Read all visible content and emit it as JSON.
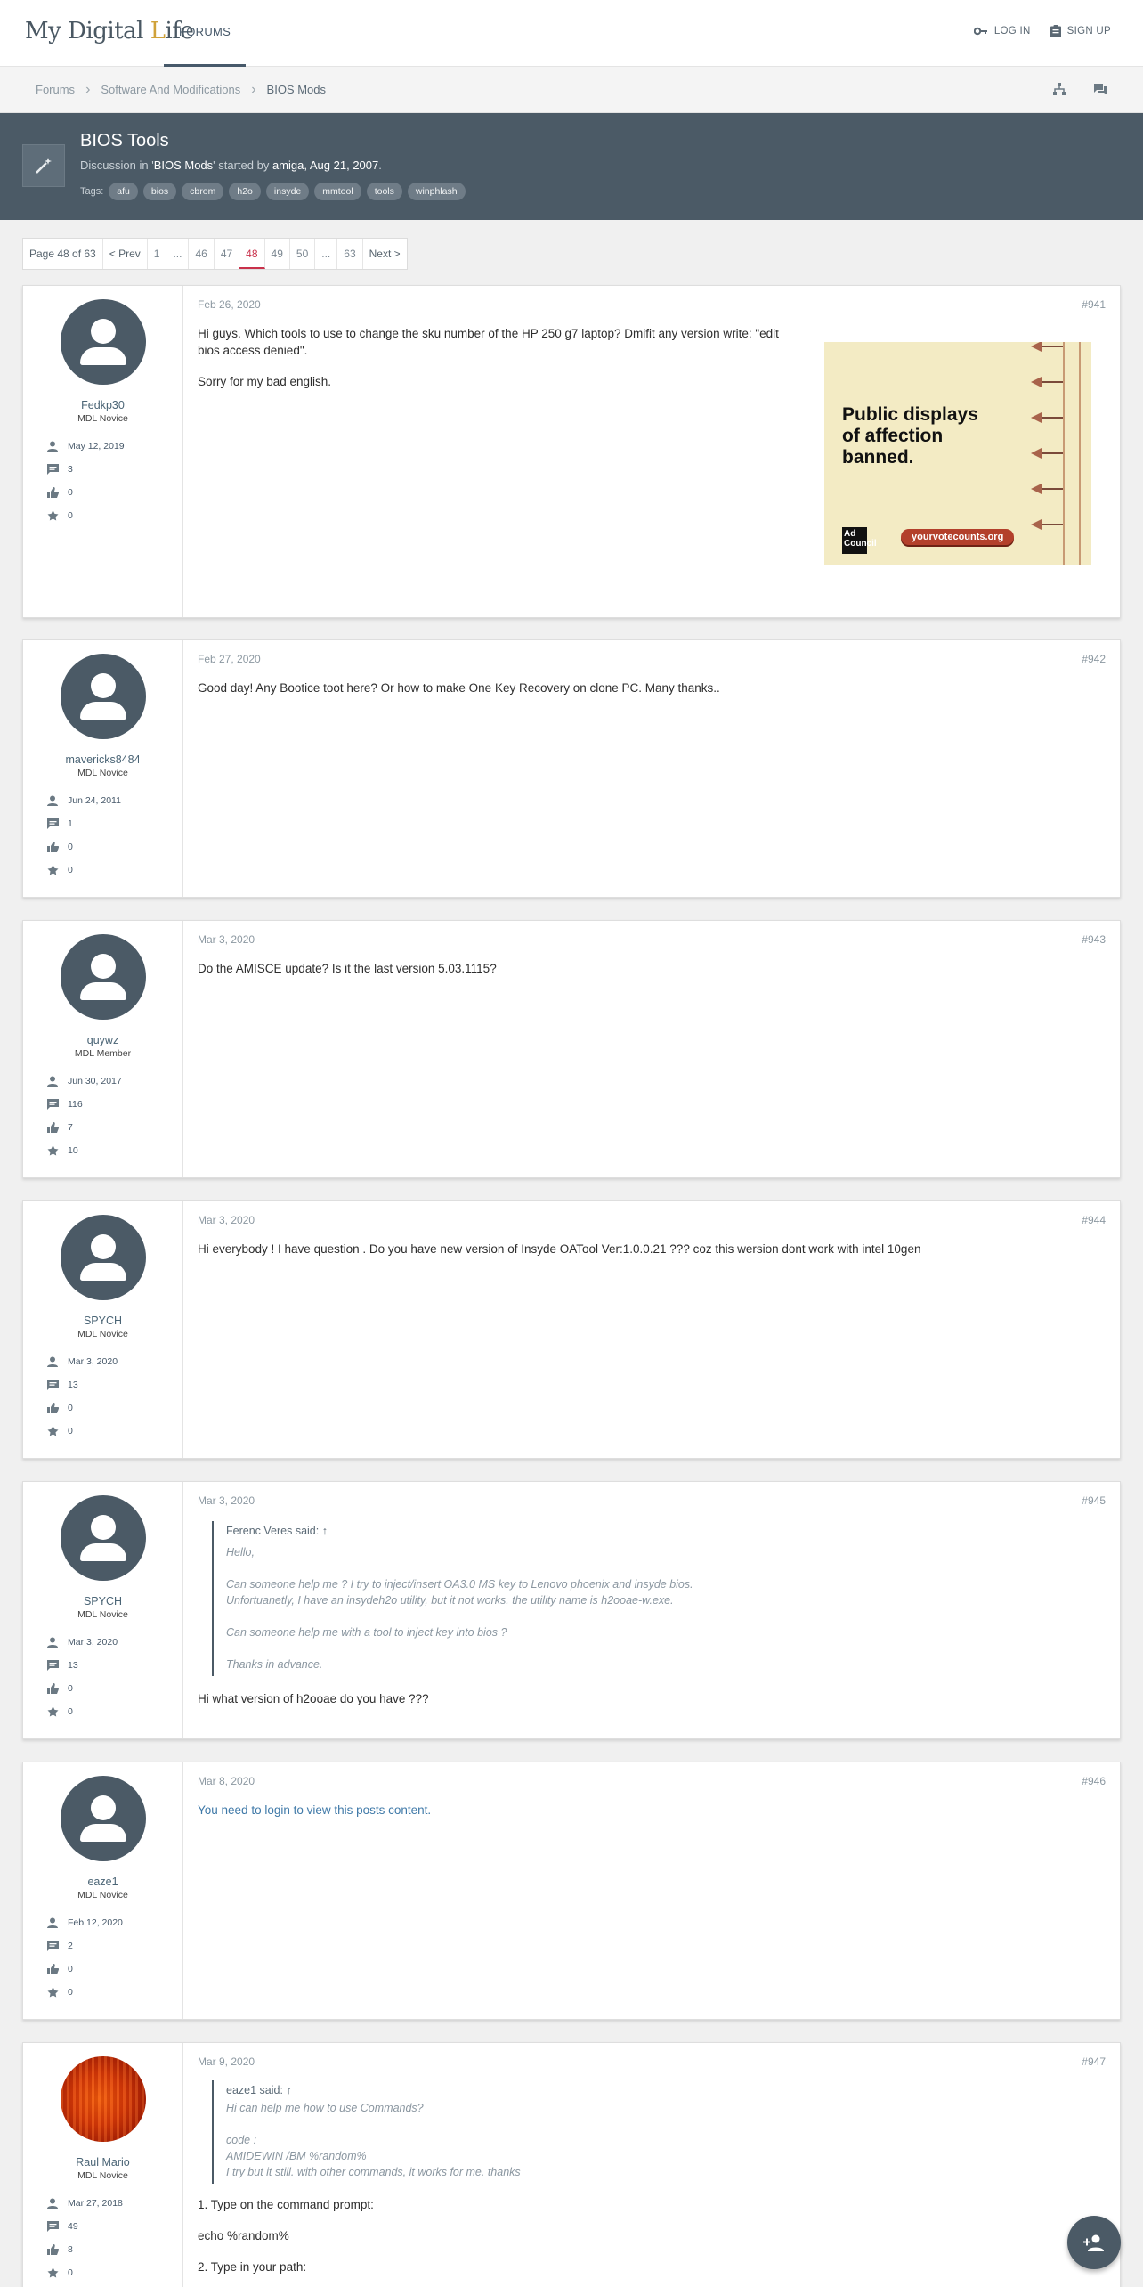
{
  "site": {
    "logo_main": "My Digital ",
    "logo_accent": "L",
    "logo_end": "ife"
  },
  "nav": {
    "forums": "FORUMS",
    "login": "LOG IN",
    "signup": "SIGN UP"
  },
  "breadcrumb": [
    "Forums",
    "Software And Modifications",
    "BIOS Mods"
  ],
  "thread": {
    "title": "BIOS Tools",
    "meta_prefix": "Discussion in '",
    "meta_forum": "BIOS Mods",
    "meta_mid": "' started by ",
    "meta_author": "amiga",
    "meta_sep": ", ",
    "meta_date": "Aug 21, 2007",
    "meta_end": ".",
    "tags_label": "Tags:",
    "tags": [
      "afu",
      "bios",
      "cbrom",
      "h2o",
      "insyde",
      "mmtool",
      "tools",
      "winphlash"
    ]
  },
  "pagination": {
    "label": "Page 48 of 63",
    "prev": "< Prev",
    "pages": [
      "1",
      "...",
      "46",
      "47",
      "48",
      "49",
      "50",
      "...",
      "63"
    ],
    "current": "48",
    "next": "Next >"
  },
  "posts": [
    {
      "user": "Fedkp30",
      "rank": "MDL Novice",
      "joined": "May 12, 2019",
      "messages": "3",
      "likes": "0",
      "points": "0",
      "date": "Feb 26, 2020",
      "num": "#941",
      "lines": [
        "Hi guys. Which tools to use to change the sku number of the HP 250 g7 laptop? Dmifit any version write: \"edit",
        "bios access denied\".",
        "Sorry for my bad english."
      ]
    },
    {
      "user": "mavericks8484",
      "rank": "MDL Novice",
      "joined": "Jun 24, 2011",
      "messages": "1",
      "likes": "0",
      "points": "0",
      "date": "Feb 27, 2020",
      "num": "#942",
      "lines": [
        "Good day! Any Bootice toot here? Or how to make One Key Recovery on clone PC. Many thanks.."
      ]
    },
    {
      "user": "quywz",
      "rank": "MDL Member",
      "joined": "Jun 30, 2017",
      "messages": "116",
      "likes": "7",
      "points": "10",
      "date": "Mar 3, 2020",
      "num": "#943",
      "lines": [
        "Do the AMISCE update? Is it the last version 5.03.1115?"
      ]
    },
    {
      "user": "SPYCH",
      "rank": "MDL Novice",
      "joined": "Mar 3, 2020",
      "messages": "13",
      "likes": "0",
      "points": "0",
      "date": "Mar 3, 2020",
      "num": "#944",
      "lines": [
        "Hi everybody ! I have question . Do you have new version of Insyde OATool Ver:1.0.0.21 ??? coz this wersion dont work with intel 10gen"
      ]
    },
    {
      "user": "SPYCH",
      "rank": "MDL Novice",
      "joined": "Mar 3, 2020",
      "messages": "13",
      "likes": "0",
      "points": "0",
      "date": "Mar 3, 2020",
      "num": "#945",
      "quote_head": "Ferenc Veres said: ↑",
      "quote": [
        "Hello,",
        "Can someone help me ? I try to inject/insert OA3.0 MS key to Lenovo phoenix and insyde bios.",
        "Unfortuanetly, I have an insydeh2o utility, but it not works. the utility name is h2ooae-w.exe.",
        "Can someone help me with a tool to inject key into bios ?",
        "Thanks in advance."
      ],
      "lines": [
        "Hi what version of h2ooae do you have ???"
      ]
    },
    {
      "user": "eaze1",
      "rank": "MDL Novice",
      "joined": "Feb 12, 2020",
      "messages": "2",
      "likes": "0",
      "points": "0",
      "date": "Mar 8, 2020",
      "num": "#946",
      "lines": [
        "You need to login to view this posts content."
      ]
    },
    {
      "user": "Raul Mario",
      "rank": "MDL Novice",
      "joined": "Mar 27, 2018",
      "messages": "49",
      "likes": "8",
      "points": "0",
      "date": "Mar 9, 2020",
      "num": "#947",
      "quote_head": "eaze1 said: ↑",
      "quote": [
        "Hi can help me how to use Commands?",
        "code :",
        "AMIDEWIN /BM %random%",
        "I try but it still. with other commands, it works for me. thanks"
      ],
      "lines": [
        "1. Type on the command prompt:",
        "echo %random%",
        "2. Type in your path:"
      ]
    }
  ],
  "ad": {
    "headline": [
      "Public displays",
      "of affection",
      "banned."
    ],
    "url": "yourvotecounts.org",
    "badge": "Ad Council"
  },
  "icons": {
    "login": "key-icon",
    "signup": "clipboard-icon",
    "tree": "sitemap-icon",
    "chat": "chat-icon",
    "fab": "add-user-icon"
  }
}
